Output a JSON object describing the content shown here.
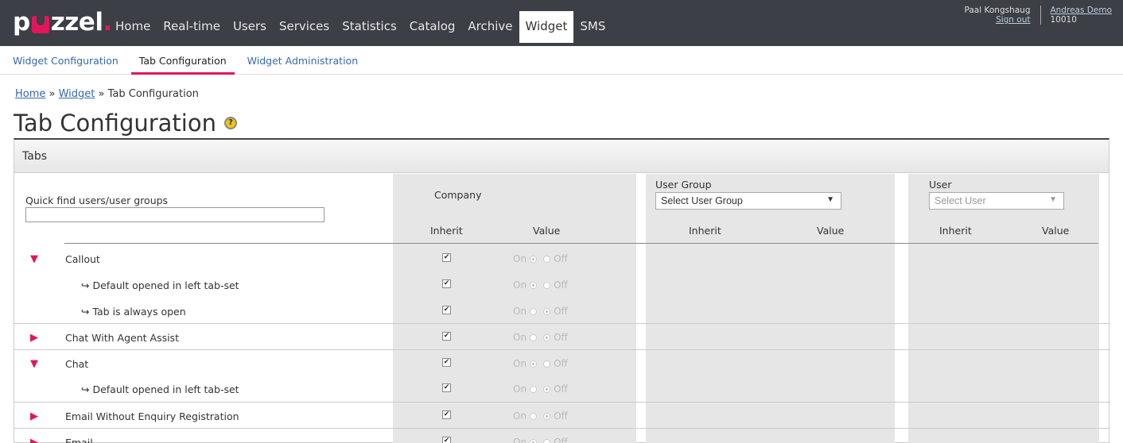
{
  "logo": {
    "text_a": "p",
    "text_b": "zzel",
    "dot": "."
  },
  "nav": [
    "Home",
    "Real-time",
    "Users",
    "Services",
    "Statistics",
    "Catalog",
    "Archive",
    "Widget",
    "SMS"
  ],
  "user": {
    "name": "Paal Kongshaug",
    "signout": "Sign out",
    "company": "Andreas Demo",
    "company_id": "10010"
  },
  "subnav": [
    "Widget Configuration",
    "Tab Configuration",
    "Widget Administration"
  ],
  "breadcrumb": {
    "home": "Home",
    "sep1": " » ",
    "widget": "Widget",
    "sep2": " » ",
    "current": "Tab Configuration"
  },
  "page_title": "Tab Configuration",
  "help_glyph": "?",
  "panel_title": "Tabs",
  "quickfind": {
    "label": "Quick find users/user groups",
    "value": ""
  },
  "company": {
    "label": "Company",
    "inherit": "Inherit",
    "value": "Value"
  },
  "user_group": {
    "label": "User Group",
    "select": "Select User Group",
    "inherit": "Inherit",
    "value": "Value"
  },
  "user_col": {
    "label": "User",
    "select": "Select User",
    "inherit": "Inherit",
    "value": "Value"
  },
  "on_label": "On",
  "off_label": "Off",
  "rows": [
    {
      "label": "Callout",
      "expanded": true,
      "sub": false,
      "inherit": true,
      "value": "On"
    },
    {
      "label": "↪ Default opened in left tab-set",
      "sub": true,
      "inherit": true,
      "value": "On"
    },
    {
      "label": "↪ Tab is always open",
      "sub": true,
      "inherit": true,
      "value": "Off"
    },
    {
      "label": "Chat With Agent Assist",
      "expanded": false,
      "sub": false,
      "inherit": true,
      "value": "Off"
    },
    {
      "label": "Chat",
      "expanded": true,
      "sub": false,
      "inherit": true,
      "value": "On"
    },
    {
      "label": "↪ Default opened in left tab-set",
      "sub": true,
      "inherit": true,
      "value": "Off"
    },
    {
      "label": "Email Without Enquiry Registration",
      "expanded": false,
      "sub": false,
      "inherit": true,
      "value": "Off"
    },
    {
      "label": "Email",
      "expanded": false,
      "sub": false,
      "inherit": true,
      "value": "On"
    }
  ],
  "colors": {
    "topbar": "#3c3f45",
    "accent": "#e2155d",
    "link": "#3568b0"
  }
}
